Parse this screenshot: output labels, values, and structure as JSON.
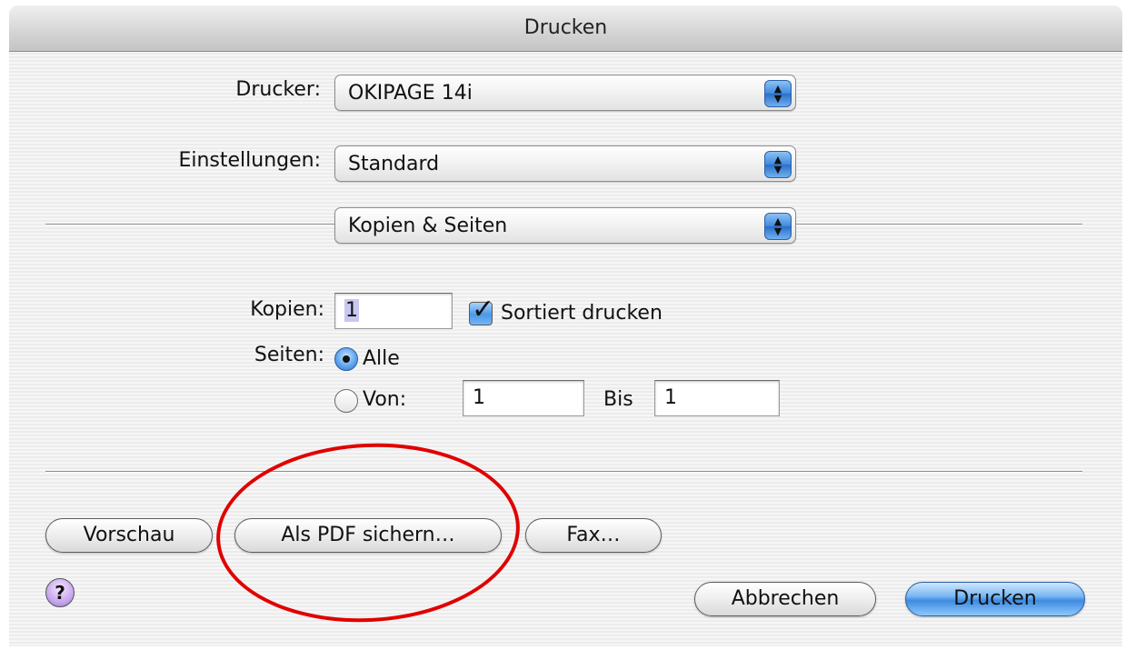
{
  "window": {
    "title": "Drucken"
  },
  "printer": {
    "label": "Drucker:",
    "value": "OKIPAGE 14i"
  },
  "presets": {
    "label": "Einstellungen:",
    "value": "Standard"
  },
  "pane": {
    "value": "Kopien & Seiten"
  },
  "copies": {
    "label": "Kopien:",
    "value": "1",
    "collate_label": "Sortiert drucken",
    "collate_checked": true
  },
  "pages": {
    "label": "Seiten:",
    "all_label": "Alle",
    "all_selected": true,
    "from_label": "Von:",
    "from_value": "1",
    "to_label": "Bis",
    "to_value": "1"
  },
  "buttons": {
    "preview": "Vorschau",
    "save_pdf": "Als PDF sichern…",
    "fax": "Fax…",
    "help": "?",
    "cancel": "Abbrechen",
    "print": "Drucken"
  },
  "colors": {
    "highlight_circle": "#e00000",
    "default_button": "#3f8be2"
  }
}
